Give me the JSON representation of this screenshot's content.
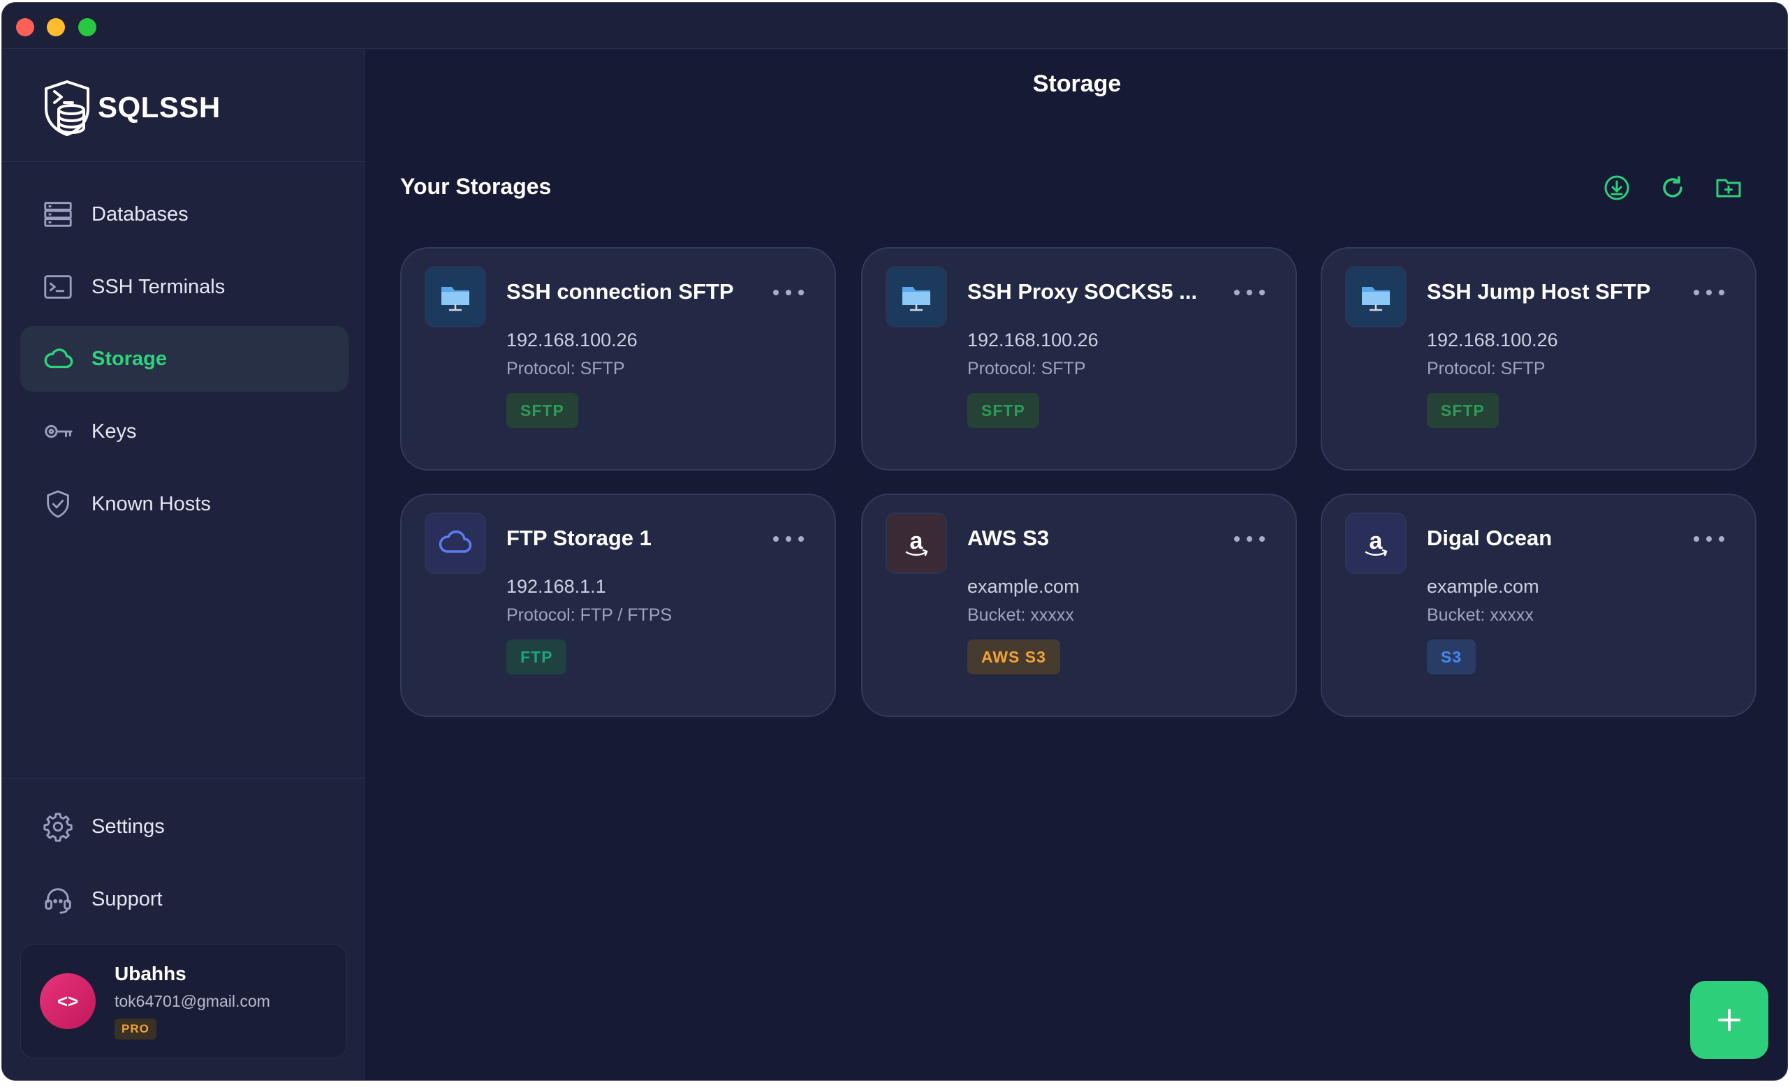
{
  "app": {
    "name": "SQLSSH",
    "page_title": "Storage"
  },
  "sidebar": {
    "nav": [
      {
        "label": "Databases",
        "icon": "database-icon",
        "active": false
      },
      {
        "label": "SSH Terminals",
        "icon": "terminal-icon",
        "active": false
      },
      {
        "label": "Storage",
        "icon": "cloud-icon",
        "active": true
      },
      {
        "label": "Keys",
        "icon": "key-icon",
        "active": false
      },
      {
        "label": "Known Hosts",
        "icon": "shield-check-icon",
        "active": false
      }
    ],
    "bottom_nav": [
      {
        "label": "Settings",
        "icon": "gear-icon"
      },
      {
        "label": "Support",
        "icon": "headset-icon"
      }
    ],
    "user": {
      "name": "Ubahhs",
      "email": "tok64701@gmail.com",
      "plan": "PRO",
      "avatar_glyph": "<>"
    }
  },
  "main": {
    "section_title": "Your Storages",
    "toolbar": [
      {
        "icon": "download-circle-icon",
        "label": "Import"
      },
      {
        "icon": "refresh-icon",
        "label": "Refresh"
      },
      {
        "icon": "folder-plus-icon",
        "label": "New folder"
      }
    ],
    "cards": [
      {
        "title": "SSH connection SFTP",
        "host": "192.168.100.26",
        "detail": "Protocol: SFTP",
        "badge": "SFTP",
        "icon": "sftp-folder-icon"
      },
      {
        "title": "SSH Proxy SOCKS5 ...",
        "host": "192.168.100.26",
        "detail": "Protocol: SFTP",
        "badge": "SFTP",
        "icon": "sftp-folder-icon"
      },
      {
        "title": "SSH Jump Host SFTP",
        "host": "192.168.100.26",
        "detail": "Protocol: SFTP",
        "badge": "SFTP",
        "icon": "sftp-folder-icon"
      },
      {
        "title": "FTP Storage 1",
        "host": "192.168.1.1",
        "detail": "Protocol: FTP / FTPS",
        "badge": "FTP",
        "icon": "cloud-icon"
      },
      {
        "title": "AWS S3",
        "host": "example.com",
        "detail": "Bucket: xxxxx",
        "badge": "AWS S3",
        "icon": "amazon-icon"
      },
      {
        "title": "Digal Ocean",
        "host": "example.com",
        "detail": "Bucket: xxxxx",
        "badge": "S3",
        "icon": "amazon-icon"
      }
    ],
    "fab": {
      "label": "+",
      "icon": "plus-icon"
    }
  },
  "colors": {
    "accent": "#2dcf7a",
    "background": "#171a34",
    "sidebar": "#1f223d",
    "card": "#232845",
    "badge_sftp": "#2f9a58",
    "badge_ftp": "#1fa37a",
    "badge_aws": "#f0a33a",
    "badge_s3": "#4a86f0"
  }
}
